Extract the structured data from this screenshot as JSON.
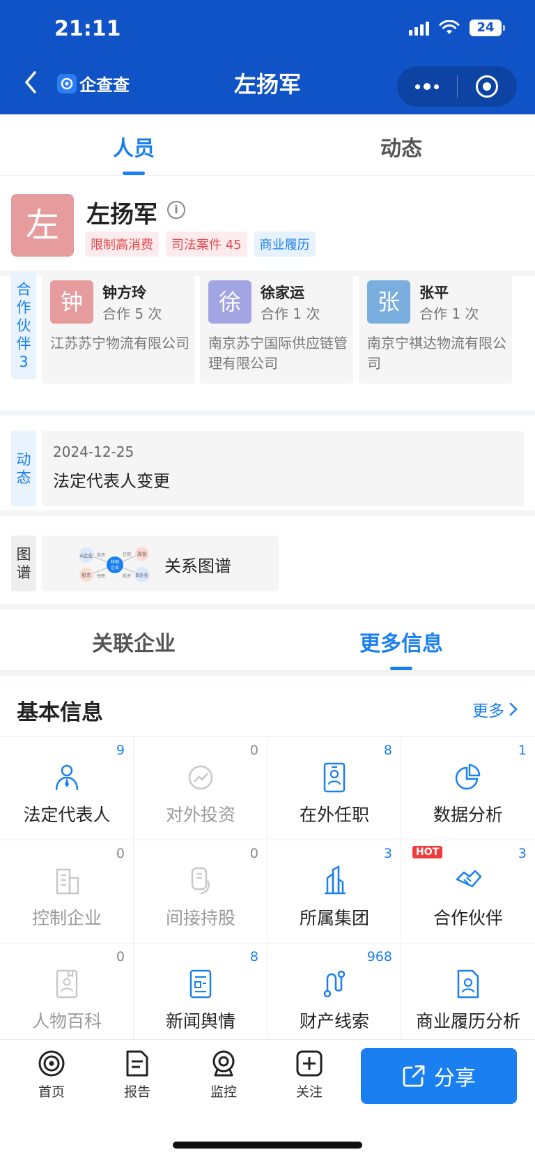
{
  "status": {
    "time": "21:11",
    "battery": "24"
  },
  "nav": {
    "brand": "企查查",
    "title": "左扬军"
  },
  "tabs": [
    {
      "label": "人员",
      "active": true
    },
    {
      "label": "动态",
      "active": false
    }
  ],
  "person": {
    "avatar_char": "左",
    "name": "左扬军",
    "tags": [
      "限制高消费",
      "司法案件 45",
      "商业履历"
    ]
  },
  "partners": {
    "side_label": [
      "合",
      "作",
      "伙",
      "伴",
      "3"
    ],
    "items": [
      {
        "avatar": "钟",
        "name": "钟方玲",
        "count": "合作 5 次",
        "company": "江苏苏宁物流有限公司",
        "color": "#e69b9d"
      },
      {
        "avatar": "徐",
        "name": "徐家运",
        "count": "合作 1 次",
        "company": "南京苏宁国际供应链管理有限公司",
        "color": "#a3a4e2"
      },
      {
        "avatar": "张",
        "name": "张平",
        "count": "合作 1 次",
        "company": "南京宁祺达物流有限公司",
        "color": "#79aede"
      }
    ]
  },
  "dynamic": {
    "side_label": [
      "动",
      "态"
    ],
    "date": "2024-12-25",
    "text": "法定代表人变更"
  },
  "graph": {
    "side_label": [
      "图",
      "谱"
    ],
    "text": "关系图谱",
    "nodes": {
      "a": "A企业",
      "invest1": "投资",
      "duty1": "任职",
      "exec": "高管",
      "center1": "样例",
      "center2": "企业",
      "holder": "股东",
      "duty2": "任职",
      "invest2": "投资",
      "b": "B企业"
    }
  },
  "tabs2": [
    {
      "label": "关联企业",
      "active": false
    },
    {
      "label": "更多信息",
      "active": true
    }
  ],
  "basic": {
    "title": "基本信息",
    "more": "更多",
    "cells": [
      {
        "label": "法定代表人",
        "count": "9",
        "icon": "person-tie-icon"
      },
      {
        "label": "对外投资",
        "count": "0",
        "icon": "investment-icon"
      },
      {
        "label": "在外任职",
        "count": "8",
        "icon": "id-card-icon"
      },
      {
        "label": "数据分析",
        "count": "1",
        "icon": "pie-chart-icon"
      },
      {
        "label": "控制企业",
        "count": "0",
        "icon": "building-icon"
      },
      {
        "label": "间接持股",
        "count": "0",
        "icon": "share-holding-icon"
      },
      {
        "label": "所属集团",
        "count": "3",
        "icon": "group-building-icon"
      },
      {
        "label": "合作伙伴",
        "count": "3",
        "icon": "handshake-icon",
        "badge": "HOT"
      },
      {
        "label": "人物百科",
        "count": "0",
        "icon": "encyclopedia-icon"
      },
      {
        "label": "新闻舆情",
        "count": "8",
        "icon": "news-icon"
      },
      {
        "label": "财产线索",
        "count": "968",
        "icon": "property-clue-icon"
      },
      {
        "label": "商业履历分析",
        "count": "",
        "icon": "resume-analysis-icon"
      }
    ]
  },
  "bottom": {
    "items": [
      "首页",
      "报告",
      "监控",
      "关注"
    ],
    "share": "分享"
  },
  "colors": {
    "header_blue": "#1053c7",
    "accent": "#1a7ff0",
    "tag_red": "#e5484d"
  }
}
